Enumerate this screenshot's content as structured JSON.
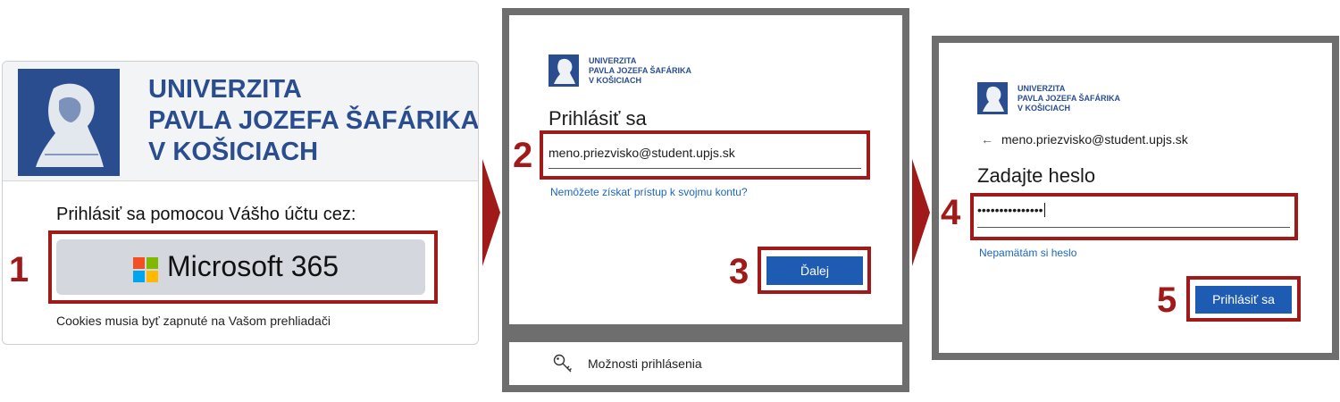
{
  "university": {
    "line1": "UNIVERZITA",
    "line2": "PAVLA JOZEFA ŠAFÁRIKA",
    "line3": "V KOŠICIACH"
  },
  "panel1": {
    "prompt": "Prihlásiť sa pomocou Vášho účtu cez:",
    "ms_button_label": "Microsoft 365",
    "cookies_note": "Cookies musia byť zapnuté na Vašom prehliadači"
  },
  "panel2": {
    "title": "Prihlásiť sa",
    "email_value": "meno.priezvisko@student.upjs.sk",
    "no_access_link": "Nemôžete získať prístup k svojmu kontu?",
    "next_button": "Ďalej",
    "signin_options": "Možnosti prihlásenia"
  },
  "panel3": {
    "back_email": "meno.priezvisko@student.upjs.sk",
    "title": "Zadajte heslo",
    "password_value": "•••••••••••••••",
    "forgot_link": "Nepamätám si heslo",
    "signin_button": "Prihlásiť sa"
  },
  "steps": [
    "1",
    "2",
    "3",
    "4",
    "5"
  ],
  "colors": {
    "brand_blue": "#2a4d8f",
    "highlight_red": "#a11a1a",
    "button_blue": "#1e5cb3",
    "link_blue": "#1a66c0"
  },
  "icons": {
    "logo": "university-crest-portrait",
    "ms": "microsoft-logo",
    "back": "arrow-left-icon",
    "options": "key-icon"
  }
}
